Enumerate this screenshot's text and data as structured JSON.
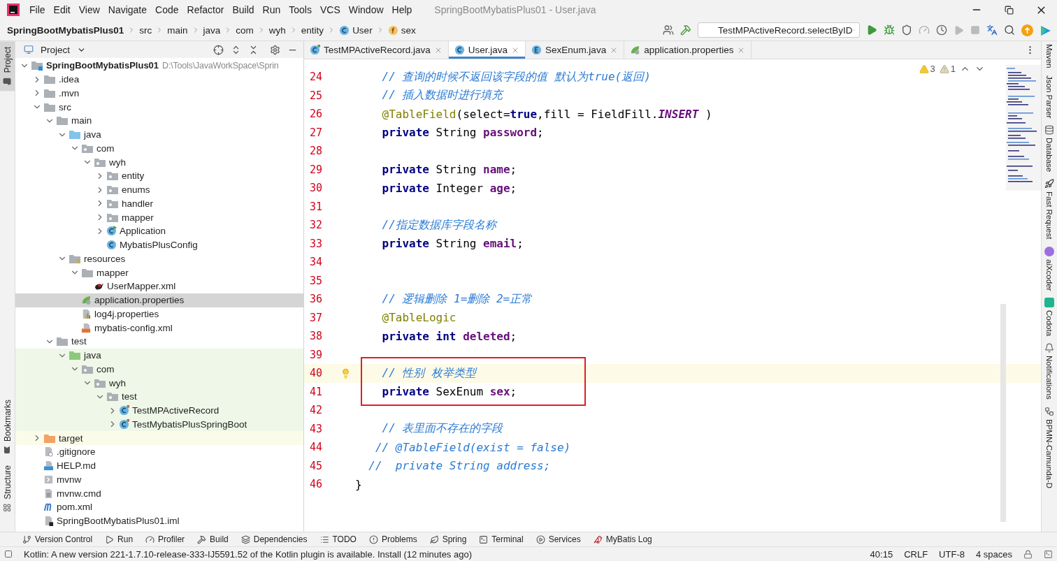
{
  "window": {
    "title": "SpringBootMybatisPlus01 - User.java"
  },
  "menu": [
    "File",
    "Edit",
    "View",
    "Navigate",
    "Code",
    "Refactor",
    "Build",
    "Run",
    "Tools",
    "VCS",
    "Window",
    "Help"
  ],
  "breadcrumbs": [
    {
      "label": "SpringBootMybatisPlus01",
      "kind": "project"
    },
    {
      "label": "src",
      "kind": "folder"
    },
    {
      "label": "main",
      "kind": "folder"
    },
    {
      "label": "java",
      "kind": "folder"
    },
    {
      "label": "com",
      "kind": "folder"
    },
    {
      "label": "wyh",
      "kind": "folder"
    },
    {
      "label": "entity",
      "kind": "folder"
    },
    {
      "label": "User",
      "kind": "class"
    },
    {
      "label": "sex",
      "kind": "field"
    }
  ],
  "run_configuration": "TestMPActiveRecord.selectByID",
  "left_stripe": [
    {
      "label": "Project",
      "selected": true,
      "kind": "top"
    },
    {
      "label": "Bookmarks",
      "selected": false,
      "kind": "bottom"
    },
    {
      "label": "Structure",
      "selected": false,
      "kind": "bottom"
    }
  ],
  "project": {
    "title": "Project",
    "tree": [
      {
        "name": "SpringBootMybatisPlus01",
        "path": "D:\\Tools\\JavaWorkSpace\\Sprin",
        "kind": "module",
        "expanded": true,
        "selected": false,
        "children": [
          {
            "name": ".idea",
            "kind": "folder",
            "expanded": false,
            "selected": false
          },
          {
            "name": ".mvn",
            "kind": "folder",
            "expanded": false,
            "selected": false
          },
          {
            "name": "src",
            "kind": "folder",
            "expanded": true,
            "selected": false,
            "children": [
              {
                "name": "main",
                "kind": "folder",
                "expanded": true,
                "selected": false,
                "children": [
                  {
                    "name": "java",
                    "kind": "source",
                    "expanded": true,
                    "selected": false,
                    "children": [
                      {
                        "name": "com",
                        "kind": "package",
                        "expanded": true,
                        "selected": false,
                        "children": [
                          {
                            "name": "wyh",
                            "kind": "package",
                            "expanded": true,
                            "selected": false,
                            "children": [
                              {
                                "name": "entity",
                                "kind": "package",
                                "expanded": false,
                                "selected": false
                              },
                              {
                                "name": "enums",
                                "kind": "package",
                                "expanded": false,
                                "selected": false
                              },
                              {
                                "name": "handler",
                                "kind": "package",
                                "expanded": false,
                                "selected": false
                              },
                              {
                                "name": "mapper",
                                "kind": "package",
                                "expanded": false,
                                "selected": false
                              },
                              {
                                "name": "Application",
                                "kind": "spring-class",
                                "expanded": false,
                                "selected": false
                              },
                              {
                                "name": "MybatisPlusConfig",
                                "kind": "class",
                                "selected": false
                              }
                            ]
                          }
                        ]
                      }
                    ]
                  },
                  {
                    "name": "resources",
                    "kind": "resources",
                    "expanded": true,
                    "selected": false,
                    "children": [
                      {
                        "name": "mapper",
                        "kind": "folder",
                        "expanded": true,
                        "selected": false,
                        "children": [
                          {
                            "name": "UserMapper.xml",
                            "kind": "mybatis",
                            "selected": false
                          }
                        ]
                      },
                      {
                        "name": "application.properties",
                        "kind": "spring-props",
                        "selected": true
                      },
                      {
                        "name": "log4j.properties",
                        "kind": "props",
                        "selected": false
                      },
                      {
                        "name": "mybatis-config.xml",
                        "kind": "xml",
                        "selected": false
                      }
                    ]
                  }
                ]
              },
              {
                "name": "test",
                "kind": "folder",
                "expanded": true,
                "selected": false,
                "children": [
                  {
                    "name": "java",
                    "kind": "test-source",
                    "expanded": true,
                    "selected": false,
                    "children": [
                      {
                        "name": "com",
                        "kind": "package",
                        "expanded": true,
                        "selected": false,
                        "children": [
                          {
                            "name": "wyh",
                            "kind": "package",
                            "expanded": true,
                            "selected": false,
                            "children": [
                              {
                                "name": "test",
                                "kind": "package",
                                "expanded": true,
                                "selected": false,
                                "children": [
                                  {
                                    "name": "TestMPActiveRecord",
                                    "kind": "test-class",
                                    "expanded": false,
                                    "selected": false
                                  },
                                  {
                                    "name": "TestMybatisPlusSpringBoot",
                                    "kind": "test-class",
                                    "expanded": false,
                                    "selected": false
                                  }
                                ]
                              }
                            ]
                          }
                        ]
                      }
                    ]
                  }
                ]
              }
            ]
          },
          {
            "name": "target",
            "kind": "excluded",
            "expanded": false,
            "selected": false
          },
          {
            "name": ".gitignore",
            "kind": "ignore",
            "selected": false
          },
          {
            "name": "HELP.md",
            "kind": "md",
            "selected": false
          },
          {
            "name": "mvnw",
            "kind": "script",
            "selected": false
          },
          {
            "name": "mvnw.cmd",
            "kind": "text",
            "selected": false
          },
          {
            "name": "pom.xml",
            "kind": "maven",
            "selected": false
          },
          {
            "name": "SpringBootMybatisPlus01.iml",
            "kind": "iml",
            "selected": false
          }
        ]
      }
    ]
  },
  "tabs": [
    {
      "label": "TestMPActiveRecord.java",
      "kind": "test-class",
      "selected": false
    },
    {
      "label": "User.java",
      "kind": "class",
      "selected": true
    },
    {
      "label": "SexEnum.java",
      "kind": "enum",
      "selected": false
    },
    {
      "label": "application.properties",
      "kind": "spring-props",
      "selected": false
    }
  ],
  "inspections": [
    {
      "kind": "warning",
      "count": "3"
    },
    {
      "kind": "weak",
      "count": "1"
    }
  ],
  "code": [
    {
      "number": "24",
      "tokens": [
        {
          "kind": "comment",
          "text": "    // 查询的时候不返回该字段的值 默认为true(返回)"
        }
      ]
    },
    {
      "number": "25",
      "tokens": [
        {
          "kind": "comment",
          "text": "    // 插入数据时进行填充"
        }
      ]
    },
    {
      "number": "26",
      "tokens": [
        {
          "kind": "annotation",
          "text": "    @TableField"
        },
        {
          "kind": "plain",
          "text": "(select="
        },
        {
          "kind": "keyword",
          "text": "true"
        },
        {
          "kind": "plain",
          "text": ",fill = FieldFill."
        },
        {
          "kind": "constant",
          "text": "INSERT"
        },
        {
          "kind": "plain",
          "text": " )"
        }
      ]
    },
    {
      "number": "27",
      "tokens": [
        {
          "kind": "keyword",
          "text": "    private"
        },
        {
          "kind": "plain",
          "text": " String "
        },
        {
          "kind": "field",
          "text": "password"
        },
        {
          "kind": "plain",
          "text": ";"
        }
      ]
    },
    {
      "number": "28"
    },
    {
      "number": "29",
      "tokens": [
        {
          "kind": "keyword",
          "text": "    private"
        },
        {
          "kind": "plain",
          "text": " String "
        },
        {
          "kind": "field",
          "text": "name"
        },
        {
          "kind": "plain",
          "text": ";"
        }
      ]
    },
    {
      "number": "30",
      "tokens": [
        {
          "kind": "keyword",
          "text": "    private"
        },
        {
          "kind": "plain",
          "text": " Integer "
        },
        {
          "kind": "field",
          "text": "age"
        },
        {
          "kind": "plain",
          "text": ";"
        }
      ]
    },
    {
      "number": "31"
    },
    {
      "number": "32",
      "tokens": [
        {
          "kind": "comment",
          "text": "    //指定数据库字段名称"
        }
      ]
    },
    {
      "number": "33",
      "tokens": [
        {
          "kind": "keyword",
          "text": "    private"
        },
        {
          "kind": "plain",
          "text": " String "
        },
        {
          "kind": "field",
          "text": "email"
        },
        {
          "kind": "plain",
          "text": ";"
        }
      ]
    },
    {
      "number": "34"
    },
    {
      "number": "35"
    },
    {
      "number": "36",
      "tokens": [
        {
          "kind": "comment",
          "text": "    // 逻辑删除 1=删除 2=正常"
        }
      ]
    },
    {
      "number": "37",
      "tokens": [
        {
          "kind": "annotation",
          "text": "    @TableLogic"
        }
      ]
    },
    {
      "number": "38",
      "tokens": [
        {
          "kind": "keyword",
          "text": "    private int"
        },
        {
          "kind": "field",
          "text": " deleted"
        },
        {
          "kind": "plain",
          "text": ";"
        }
      ]
    },
    {
      "number": "39"
    },
    {
      "number": "40",
      "current": true,
      "boxed": true,
      "tokens": [
        {
          "kind": "comment",
          "text": "    // 性别 枚举类型"
        }
      ]
    },
    {
      "number": "41",
      "boxed": true,
      "tokens": [
        {
          "kind": "keyword",
          "text": "    private"
        },
        {
          "kind": "plain",
          "text": " SexEnum "
        },
        {
          "kind": "field",
          "text": "sex"
        },
        {
          "kind": "plain",
          "text": ";"
        }
      ]
    },
    {
      "number": "42"
    },
    {
      "number": "43",
      "tokens": [
        {
          "kind": "comment",
          "text": "    // 表里面不存在的字段"
        }
      ]
    },
    {
      "number": "44",
      "tokens": [
        {
          "kind": "comment",
          "text": "   // @TableField(exist = false)"
        }
      ]
    },
    {
      "number": "45",
      "tokens": [
        {
          "kind": "comment",
          "text": "  //  private String address;"
        }
      ]
    },
    {
      "number": "46",
      "tokens": [
        {
          "kind": "plain",
          "text": "}"
        }
      ]
    }
  ],
  "right_stripe": [
    {
      "label": "Maven",
      "kind": "plain"
    },
    {
      "label": "Json Parser",
      "kind": "plain"
    },
    {
      "label": "Database",
      "kind": "database"
    },
    {
      "label": "Fast Request",
      "kind": "rocket"
    },
    {
      "label": "aiXcoder",
      "kind": "ai"
    },
    {
      "label": "Codota",
      "kind": "codota"
    },
    {
      "label": "Notifications",
      "kind": "bell"
    },
    {
      "label": "BPMN-Camunda-D",
      "kind": "bpmn"
    }
  ],
  "tool_windows": [
    {
      "label": "Version Control",
      "kind": "vcs"
    },
    {
      "label": "Run",
      "kind": "run"
    },
    {
      "label": "Profiler",
      "kind": "profiler"
    },
    {
      "label": "Build",
      "kind": "build"
    },
    {
      "label": "Dependencies",
      "kind": "deps"
    },
    {
      "label": "TODO",
      "kind": "todo"
    },
    {
      "label": "Problems",
      "kind": "problems"
    },
    {
      "label": "Spring",
      "kind": "spring"
    },
    {
      "label": "Terminal",
      "kind": "terminal"
    },
    {
      "label": "Services",
      "kind": "services"
    },
    {
      "label": "MyBatis Log",
      "kind": "mybatis"
    }
  ],
  "status_bar": {
    "message": "Kotlin: A new version 221-1.7.10-release-333-IJ5591.52 of the Kotlin plugin is available. Install (12 minutes ago)",
    "position": "40:15",
    "line_separator": "CRLF",
    "encoding": "UTF-8",
    "indent": "4 spaces"
  }
}
